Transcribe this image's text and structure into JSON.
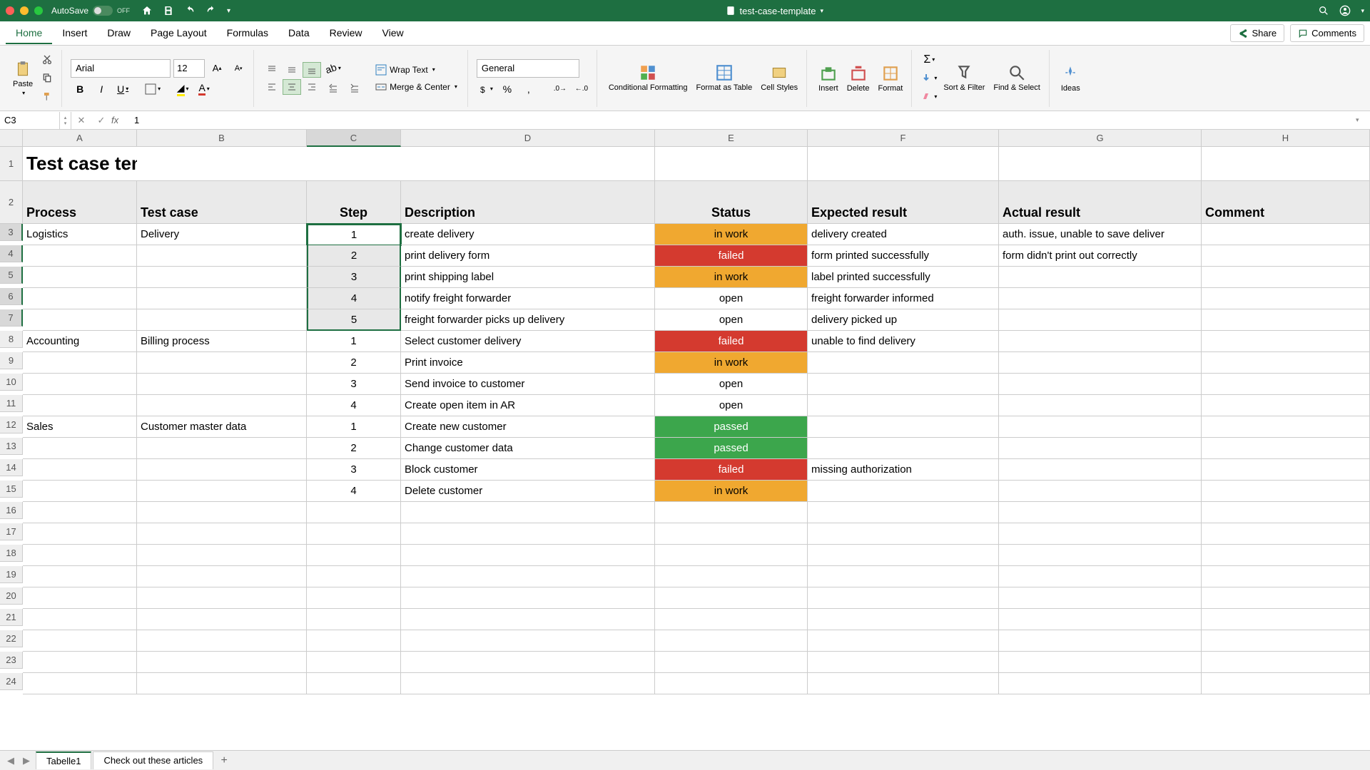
{
  "title_bar": {
    "autosave_label": "AutoSave",
    "autosave_state": "OFF",
    "filename": "test-case-template"
  },
  "menu": {
    "items": [
      "Home",
      "Insert",
      "Draw",
      "Page Layout",
      "Formulas",
      "Data",
      "Review",
      "View"
    ],
    "share": "Share",
    "comments": "Comments"
  },
  "ribbon": {
    "paste": "Paste",
    "font_name": "Arial",
    "font_size": "12",
    "wrap_text": "Wrap Text",
    "merge_center": "Merge & Center",
    "number_format": "General",
    "cond_fmt": "Conditional Formatting",
    "fmt_table": "Format as Table",
    "cell_styles": "Cell Styles",
    "insert": "Insert",
    "delete": "Delete",
    "format": "Format",
    "sort_filter": "Sort & Filter",
    "find_select": "Find & Select",
    "ideas": "Ideas"
  },
  "formula_bar": {
    "name_box": "C3",
    "formula": "1"
  },
  "sheet": {
    "columns": [
      "A",
      "B",
      "C",
      "D",
      "E",
      "F",
      "G",
      "H"
    ],
    "title": "Test case template",
    "headers": {
      "process": "Process",
      "test_case": "Test case",
      "step": "Step",
      "description": "Description",
      "status": "Status",
      "expected": "Expected result",
      "actual": "Actual result",
      "comment": "Comment"
    },
    "rows": [
      {
        "r": 3,
        "process": "Logistics",
        "test_case": "Delivery",
        "step": "1",
        "description": "create delivery",
        "status": "in work",
        "status_cls": "st-inwork",
        "expected": "delivery created",
        "actual": "auth. issue, unable to save deliver"
      },
      {
        "r": 4,
        "process": "",
        "test_case": "",
        "step": "2",
        "description": "print delivery form",
        "status": "failed",
        "status_cls": "st-failed",
        "expected": "form printed successfully",
        "actual": "form didn't print out correctly"
      },
      {
        "r": 5,
        "process": "",
        "test_case": "",
        "step": "3",
        "description": "print shipping label",
        "status": "in work",
        "status_cls": "st-inwork",
        "expected": "label printed successfully",
        "actual": ""
      },
      {
        "r": 6,
        "process": "",
        "test_case": "",
        "step": "4",
        "description": "notify freight forwarder",
        "status": "open",
        "status_cls": "st-open",
        "expected": "freight forwarder informed",
        "actual": ""
      },
      {
        "r": 7,
        "process": "",
        "test_case": "",
        "step": "5",
        "description": "freight forwarder picks up delivery",
        "status": "open",
        "status_cls": "st-open",
        "expected": "delivery picked up",
        "actual": ""
      },
      {
        "r": 8,
        "process": "Accounting",
        "test_case": "Billing process",
        "step": "1",
        "description": "Select customer delivery",
        "status": "failed",
        "status_cls": "st-failed",
        "expected": "unable to find delivery",
        "actual": ""
      },
      {
        "r": 9,
        "process": "",
        "test_case": "",
        "step": "2",
        "description": "Print invoice",
        "status": "in work",
        "status_cls": "st-inwork",
        "expected": "",
        "actual": ""
      },
      {
        "r": 10,
        "process": "",
        "test_case": "",
        "step": "3",
        "description": "Send invoice to customer",
        "status": "open",
        "status_cls": "st-open",
        "expected": "",
        "actual": ""
      },
      {
        "r": 11,
        "process": "",
        "test_case": "",
        "step": "4",
        "description": "Create open item in AR",
        "status": "open",
        "status_cls": "st-open",
        "expected": "",
        "actual": ""
      },
      {
        "r": 12,
        "process": "Sales",
        "test_case": "Customer master data",
        "step": "1",
        "description": "Create new customer",
        "status": "passed",
        "status_cls": "st-passed",
        "expected": "",
        "actual": ""
      },
      {
        "r": 13,
        "process": "",
        "test_case": "",
        "step": "2",
        "description": "Change customer data",
        "status": "passed",
        "status_cls": "st-passed",
        "expected": "",
        "actual": ""
      },
      {
        "r": 14,
        "process": "",
        "test_case": "",
        "step": "3",
        "description": "Block customer",
        "status": "failed",
        "status_cls": "st-failed",
        "expected": "missing authorization",
        "actual": ""
      },
      {
        "r": 15,
        "process": "",
        "test_case": "",
        "step": "4",
        "description": "Delete customer",
        "status": "in work",
        "status_cls": "st-inwork",
        "expected": "",
        "actual": ""
      }
    ],
    "empty_rows": [
      16,
      17,
      18,
      19,
      20,
      21,
      22,
      23,
      24
    ]
  },
  "tabs": {
    "sheets": [
      "Tabelle1",
      "Check out these articles"
    ]
  },
  "selection": {
    "active": "C3",
    "range_start_row": 3,
    "range_end_row": 7,
    "col": "C"
  },
  "chart_data": {
    "type": "table",
    "title": "Test case template",
    "columns": [
      "Process",
      "Test case",
      "Step",
      "Description",
      "Status",
      "Expected result",
      "Actual result",
      "Comment"
    ],
    "rows": [
      [
        "Logistics",
        "Delivery",
        1,
        "create delivery",
        "in work",
        "delivery created",
        "auth. issue, unable to save deliver",
        ""
      ],
      [
        "",
        "",
        2,
        "print delivery form",
        "failed",
        "form printed successfully",
        "form didn't print out correctly",
        ""
      ],
      [
        "",
        "",
        3,
        "print shipping label",
        "in work",
        "label printed successfully",
        "",
        ""
      ],
      [
        "",
        "",
        4,
        "notify freight forwarder",
        "open",
        "freight forwarder informed",
        "",
        ""
      ],
      [
        "",
        "",
        5,
        "freight forwarder picks up delivery",
        "open",
        "delivery picked up",
        "",
        ""
      ],
      [
        "Accounting",
        "Billing process",
        1,
        "Select customer delivery",
        "failed",
        "unable to find delivery",
        "",
        ""
      ],
      [
        "",
        "",
        2,
        "Print invoice",
        "in work",
        "",
        "",
        ""
      ],
      [
        "",
        "",
        3,
        "Send invoice to customer",
        "open",
        "",
        "",
        ""
      ],
      [
        "",
        "",
        4,
        "Create open item in AR",
        "open",
        "",
        "",
        ""
      ],
      [
        "Sales",
        "Customer master data",
        1,
        "Create new customer",
        "passed",
        "",
        "",
        ""
      ],
      [
        "",
        "",
        2,
        "Change customer data",
        "passed",
        "",
        "",
        ""
      ],
      [
        "",
        "",
        3,
        "Block customer",
        "failed",
        "missing authorization",
        "",
        ""
      ],
      [
        "",
        "",
        4,
        "Delete customer",
        "in work",
        "",
        "",
        ""
      ]
    ]
  }
}
